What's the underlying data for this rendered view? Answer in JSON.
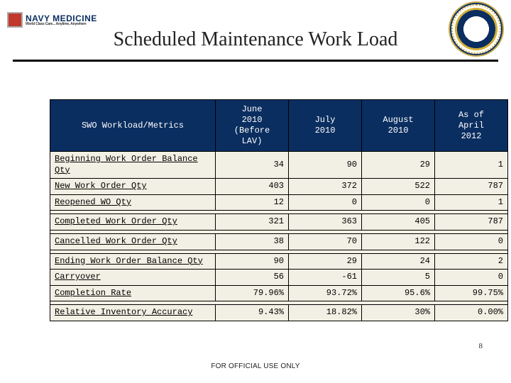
{
  "header": {
    "brand_line1": "NAVY MEDICINE",
    "brand_line2": "World Class Care... Anytime, Anywhere"
  },
  "title": "Scheduled Maintenance Work Load",
  "footer": {
    "classification": "FOR OFFICIAL USE ONLY",
    "page": "8"
  },
  "table": {
    "row_header": "SWO Workload/Metrics",
    "columns": [
      "June\n2010\n(Before\nLAV)",
      "July\n2010",
      "August\n2010",
      "As of\nApril\n2012"
    ],
    "rows": [
      {
        "label": "Beginning Work Order Balance Qty",
        "values": [
          "34",
          "90",
          "29",
          "1"
        ]
      },
      {
        "label": "New Work Order Qty",
        "values": [
          "403",
          "372",
          "522",
          "787"
        ]
      },
      {
        "label": "Reopened WO Qty",
        "values": [
          "12",
          "0",
          "0",
          "1"
        ]
      }
    ],
    "rows2": [
      {
        "label": "Completed Work Order Qty",
        "values": [
          "321",
          "363",
          "405",
          "787"
        ]
      }
    ],
    "rows3": [
      {
        "label": "Cancelled Work Order Qty",
        "values": [
          "38",
          "70",
          "122",
          "0"
        ]
      }
    ],
    "rows4": [
      {
        "label": "Ending Work Order Balance Qty",
        "values": [
          "90",
          "29",
          "24",
          "2"
        ]
      },
      {
        "label": "Carryover",
        "values": [
          "56",
          "-61",
          "5",
          "0"
        ]
      },
      {
        "label": "Completion Rate",
        "values": [
          "79.96%",
          "93.72%",
          "95.6%",
          "99.75%"
        ]
      }
    ],
    "rows5": [
      {
        "label": "Relative Inventory Accuracy",
        "values": [
          "9.43%",
          "18.82%",
          "30%",
          "0.00%"
        ]
      }
    ]
  },
  "chart_data": {
    "type": "table",
    "title": "Scheduled Maintenance Work Load",
    "row_header": "SWO Workload/Metrics",
    "columns": [
      "June 2010 (Before LAV)",
      "July 2010",
      "August 2010",
      "As of April 2012"
    ],
    "data": [
      {
        "metric": "Beginning Work Order Balance Qty",
        "June 2010 (Before LAV)": 34,
        "July 2010": 90,
        "August 2010": 29,
        "As of April 2012": 1
      },
      {
        "metric": "New Work Order Qty",
        "June 2010 (Before LAV)": 403,
        "July 2010": 372,
        "August 2010": 522,
        "As of April 2012": 787
      },
      {
        "metric": "Reopened WO Qty",
        "June 2010 (Before LAV)": 12,
        "July 2010": 0,
        "August 2010": 0,
        "As of April 2012": 1
      },
      {
        "metric": "Completed Work Order Qty",
        "June 2010 (Before LAV)": 321,
        "July 2010": 363,
        "August 2010": 405,
        "As of April 2012": 787
      },
      {
        "metric": "Cancelled Work Order Qty",
        "June 2010 (Before LAV)": 38,
        "July 2010": 70,
        "August 2010": 122,
        "As of April 2012": 0
      },
      {
        "metric": "Ending Work Order Balance Qty",
        "June 2010 (Before LAV)": 90,
        "July 2010": 29,
        "August 2010": 24,
        "As of April 2012": 2
      },
      {
        "metric": "Carryover",
        "June 2010 (Before LAV)": 56,
        "July 2010": -61,
        "August 2010": 5,
        "As of April 2012": 0
      },
      {
        "metric": "Completion Rate",
        "June 2010 (Before LAV)": "79.96%",
        "July 2010": "93.72%",
        "August 2010": "95.6%",
        "As of April 2012": "99.75%"
      },
      {
        "metric": "Relative Inventory Accuracy",
        "June 2010 (Before LAV)": "9.43%",
        "July 2010": "18.82%",
        "August 2010": "30%",
        "As of April 2012": "0.00%"
      }
    ]
  }
}
